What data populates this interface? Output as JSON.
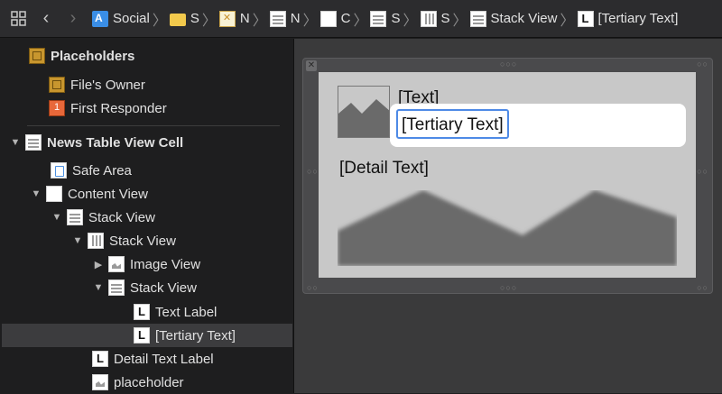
{
  "breadcrumbs": [
    {
      "label": "Social",
      "icon": "document-icon"
    },
    {
      "label": "S",
      "icon": "folder-icon"
    },
    {
      "label": "N",
      "icon": "xib-icon"
    },
    {
      "label": "N",
      "icon": "stack-icon"
    },
    {
      "label": "C",
      "icon": "view-icon"
    },
    {
      "label": "S",
      "icon": "stack-icon"
    },
    {
      "label": "S",
      "icon": "hstack-icon"
    },
    {
      "label": "Stack View",
      "icon": "stack-icon"
    },
    {
      "label": "[Tertiary Text]",
      "icon": "label-icon"
    }
  ],
  "outline": {
    "placeholders": "Placeholders",
    "files_owner": "File's Owner",
    "first_responder": "First Responder",
    "cell": "News Table View Cell",
    "safe_area": "Safe Area",
    "content_view": "Content View",
    "stack_view_1": "Stack View",
    "stack_view_2": "Stack View",
    "image_view": "Image View",
    "stack_view_3": "Stack View",
    "text_label": "Text Label",
    "tertiary_text": "[Tertiary Text]",
    "detail_text_label": "Detail Text Label",
    "placeholder": "placeholder"
  },
  "canvas": {
    "text": "[Text]",
    "tertiary": "[Tertiary Text]",
    "detail": "[Detail Text]"
  },
  "colors": {
    "selection_border": "#4e8ae6",
    "cell_background": "#c8c8c8"
  }
}
